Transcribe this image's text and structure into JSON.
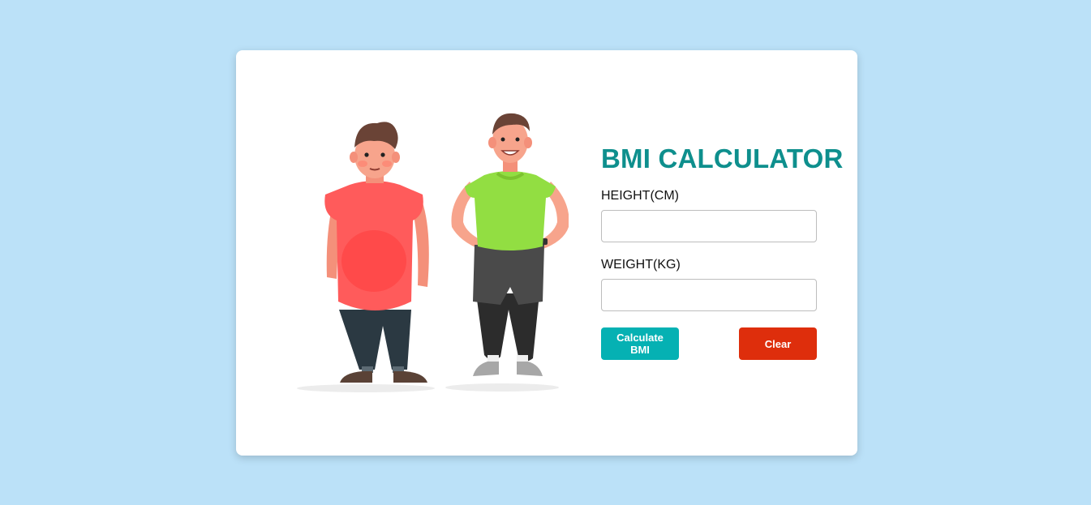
{
  "app": {
    "title": "BMI CALCULATOR"
  },
  "form": {
    "height_label": "HEIGHT(CM)",
    "height_value": "",
    "weight_label": "WEIGHT(KG)",
    "weight_value": "",
    "calculate_label": "Calculate BMI",
    "clear_label": "Clear"
  },
  "illustration": {
    "figures": [
      "overweight-man",
      "fit-man"
    ]
  },
  "colors": {
    "background": "#bbe1f8",
    "title": "#0e8f8d",
    "calculate_button": "#05b1b3",
    "clear_button": "#de2e0c",
    "card": "#ffffff"
  }
}
